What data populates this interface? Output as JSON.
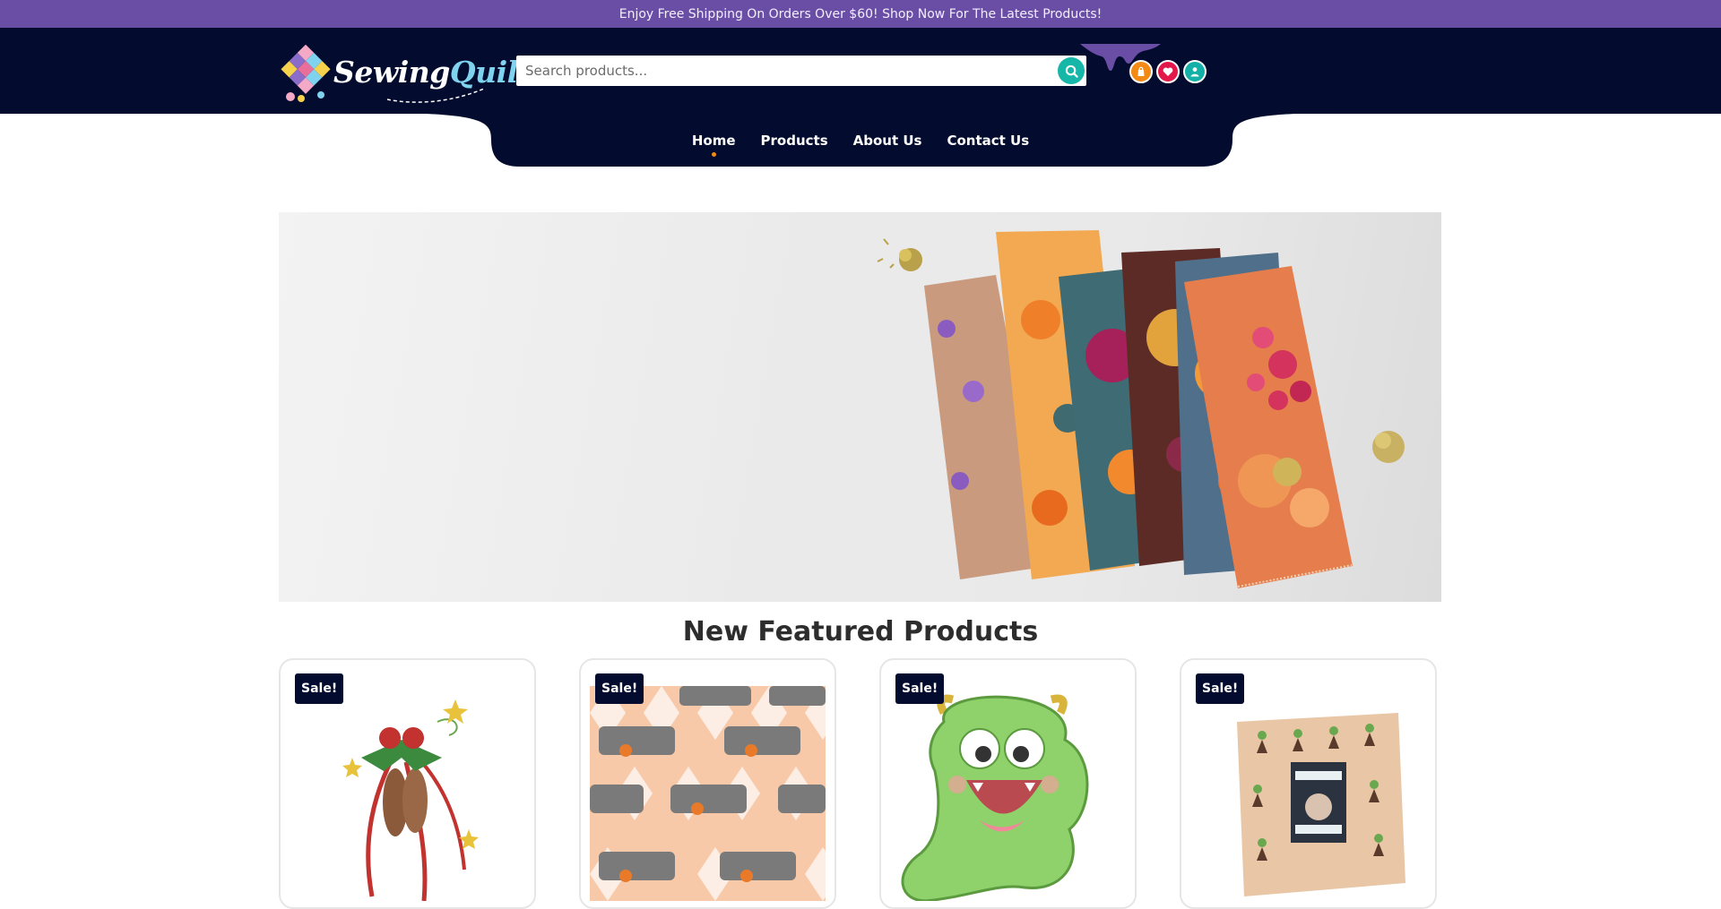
{
  "announcement": {
    "text": "Enjoy Free Shipping On Orders Over $60! Shop Now For The Latest Products!"
  },
  "brand": {
    "name_part1": "Sewing",
    "name_part2": "Quilt"
  },
  "search": {
    "placeholder": "Search products...",
    "icon": "search-icon"
  },
  "header_icons": [
    {
      "name": "cart-icon",
      "color": "#f28a15"
    },
    {
      "name": "wishlist-heart-icon",
      "color": "#e2184a"
    },
    {
      "name": "account-user-icon",
      "color": "#12b0a6"
    }
  ],
  "nav": {
    "items": [
      {
        "label": "Home",
        "active": true
      },
      {
        "label": "Products",
        "active": false
      },
      {
        "label": "About Us",
        "active": false
      },
      {
        "label": "Contact Us",
        "active": false
      }
    ]
  },
  "featured": {
    "title": "New Featured Products",
    "products": [
      {
        "badge": "Sale!"
      },
      {
        "badge": "Sale!"
      },
      {
        "badge": "Sale!"
      },
      {
        "badge": "Sale!"
      }
    ]
  },
  "colors": {
    "announcement_bg": "#6a4ea6",
    "header_bg": "#030c2e",
    "accent_teal": "#16b7a9",
    "accent_orange": "#f28a15",
    "accent_pink": "#e2184a"
  }
}
